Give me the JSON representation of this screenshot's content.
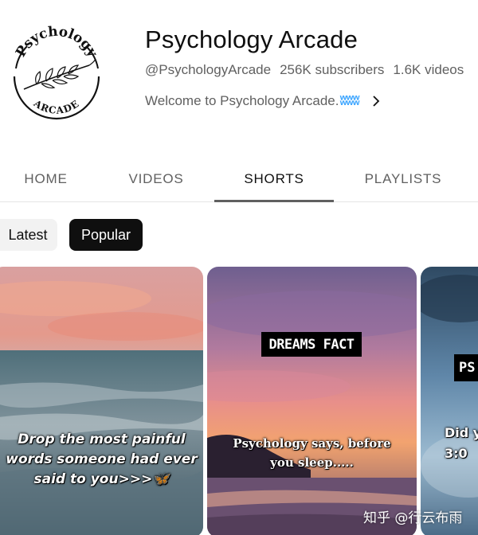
{
  "channel": {
    "name": "Psychology Arcade",
    "handle": "@PsychologyArcade",
    "subscribers": "256K subscribers",
    "videos": "1.6K videos",
    "description": "Welcome to Psychology Arcade.",
    "description_emoji": "ʬʬʬ",
    "logo_top_text": "Psychology",
    "logo_bottom_text": "ARCADE"
  },
  "tabs": [
    {
      "label": "HOME",
      "active": false
    },
    {
      "label": "VIDEOS",
      "active": false
    },
    {
      "label": "SHORTS",
      "active": true
    },
    {
      "label": "PLAYLISTS",
      "active": false
    }
  ],
  "chips": {
    "latest": "Latest",
    "popular": "Popular",
    "selected": "Popular"
  },
  "shorts": [
    {
      "overlay_lines": [
        "Drop the most painful",
        "words someone had ever",
        "said to you>>>🦋"
      ]
    },
    {
      "title_box": "DREAMS FACT",
      "caption_lines": [
        "Psychology says, before",
        "you sleep....."
      ]
    },
    {
      "title_box": "PS",
      "caption_lines": [
        "Did y",
        "3:0"
      ]
    }
  ],
  "watermark": "知乎 @行云布雨",
  "colors": {
    "accent_blue": "#3ea6ff",
    "chip_selected_bg": "#0f0f0f",
    "chip_bg": "#f2f2f2",
    "text_secondary": "#606060"
  }
}
